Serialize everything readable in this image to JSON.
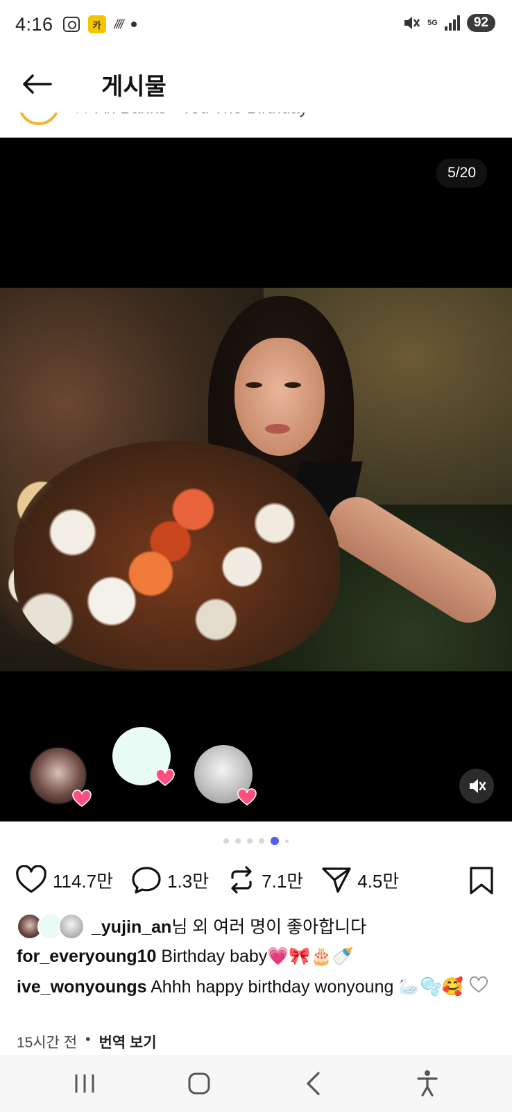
{
  "status_bar": {
    "time": "4:16",
    "app_badge": "카",
    "network": "5G",
    "battery": "92"
  },
  "header": {
    "title": "게시물"
  },
  "peek": {
    "music_text": "♪♪ Ari Banks · You The Birthday"
  },
  "media": {
    "counter": "5/20",
    "heart_color": "#ff4f81",
    "dots_total": 6,
    "dots_active_index": 4
  },
  "actions": {
    "likes": "114.7만",
    "comments": "1.3만",
    "reposts": "7.1만",
    "shares": "4.5만"
  },
  "liked_by": {
    "user": "_yujin_an",
    "suffix": "님 외 여러 명이 좋아합니다"
  },
  "comments": [
    {
      "user": "for_everyoung10",
      "text": "Birthday baby💗🎀🎂🍼"
    },
    {
      "user": "ive_wonyoungs",
      "text": "Ahhh happy birthday wonyoung 🦢🫧🥰"
    }
  ],
  "meta": {
    "time_ago": "15시간 전",
    "separator": "•",
    "translate": "번역 보기"
  },
  "colors": {
    "accent": "#4f5ff0",
    "heart": "#ff4f81"
  }
}
